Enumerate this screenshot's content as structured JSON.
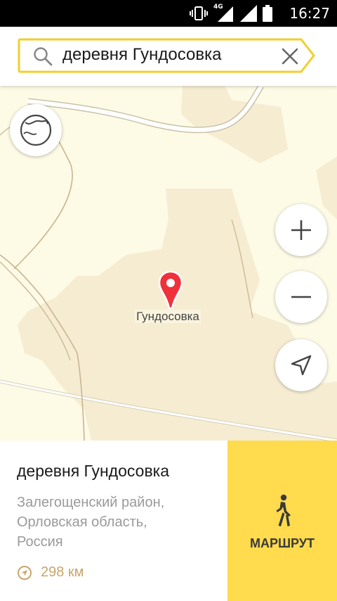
{
  "status_bar": {
    "time": "16:27",
    "network": "4G"
  },
  "search": {
    "query": "деревня Гундосовка"
  },
  "map": {
    "place_label": "Гундосовка"
  },
  "card": {
    "title": "деревня Гундосовка",
    "address_lines": [
      "Залегощенский район,",
      "Орловская область,",
      "Россия"
    ],
    "distance": "298 км"
  },
  "route_button": {
    "label": "МАРШРУТ"
  },
  "colors": {
    "accent": "#ffdb4d",
    "pin": "#f0303a",
    "map_bg": "#fdfae6",
    "settlement": "#f5ecd2",
    "distance_text": "#c9a56a"
  }
}
